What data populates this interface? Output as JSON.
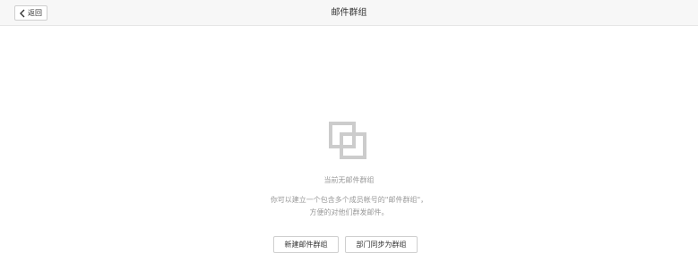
{
  "header": {
    "back_label": "返回",
    "title": "邮件群组"
  },
  "empty_state": {
    "icon": "empty-groups-icon",
    "title": "当前无邮件群组",
    "description_line1": "你可以建立一个包含多个成员帐号的\"邮件群组\"，",
    "description_line2": "方便的对他们群发邮件。"
  },
  "actions": {
    "new_group_label": "新建邮件群组",
    "sync_department_label": "部门同步为群组"
  },
  "colors": {
    "header_bg": "#f7f7f7",
    "icon_gray": "#cccccc",
    "muted_text": "#999999"
  }
}
